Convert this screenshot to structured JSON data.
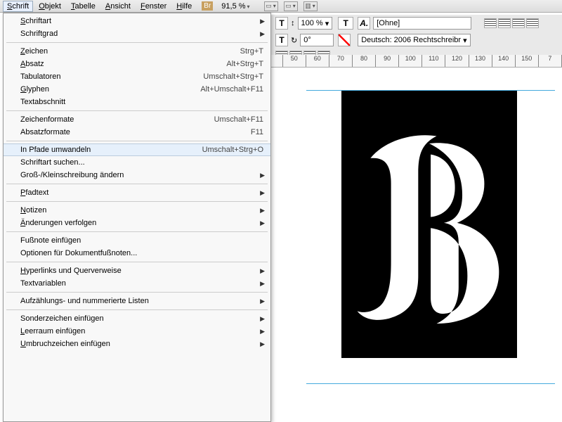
{
  "menubar": {
    "schrift": "Schrift",
    "objekt": "Objekt",
    "tabelle": "Tabelle",
    "ansicht": "Ansicht",
    "fenster": "Fenster",
    "hilfe": "Hilfe",
    "br": "Br",
    "zoom": "91,5 %"
  },
  "controls": {
    "scale": "100 %",
    "rotation": "0°",
    "style": "[Ohne]",
    "lang": "Deutsch: 2006 Rechtschreibr"
  },
  "ruler": [
    "50",
    "60",
    "70",
    "80",
    "90",
    "100",
    "110",
    "120",
    "130",
    "140",
    "150",
    "7"
  ],
  "menu": {
    "schriftart": "Schriftart",
    "schriftgrad": "Schriftgrad",
    "zeichen": "Zeichen",
    "zeichen_sc": "Strg+T",
    "absatz": "Absatz",
    "absatz_sc": "Alt+Strg+T",
    "tabulatoren": "Tabulatoren",
    "tabulatoren_sc": "Umschalt+Strg+T",
    "glyphen": "Glyphen",
    "glyphen_sc": "Alt+Umschalt+F11",
    "textabschnitt": "Textabschnitt",
    "zeichenformate": "Zeichenformate",
    "zeichenformate_sc": "Umschalt+F11",
    "absatzformate": "Absatzformate",
    "absatzformate_sc": "F11",
    "inpfade": "In Pfade umwandeln",
    "inpfade_sc": "Umschalt+Strg+O",
    "schriftart_suchen": "Schriftart suchen...",
    "gross": "Groß-/Kleinschreibung ändern",
    "pfadtext": "Pfadtext",
    "notizen": "Notizen",
    "aenderungen": "Änderungen verfolgen",
    "fussnote": "Fußnote einfügen",
    "optionen": "Optionen für Dokumentfußnoten...",
    "hyperlinks": "Hyperlinks und Querverweise",
    "textvar": "Textvariablen",
    "listen": "Aufzählungs- und nummerierte Listen",
    "sonder": "Sonderzeichen einfügen",
    "leerraum": "Leerraum einfügen",
    "umbruch": "Umbruchzeichen einfügen"
  }
}
